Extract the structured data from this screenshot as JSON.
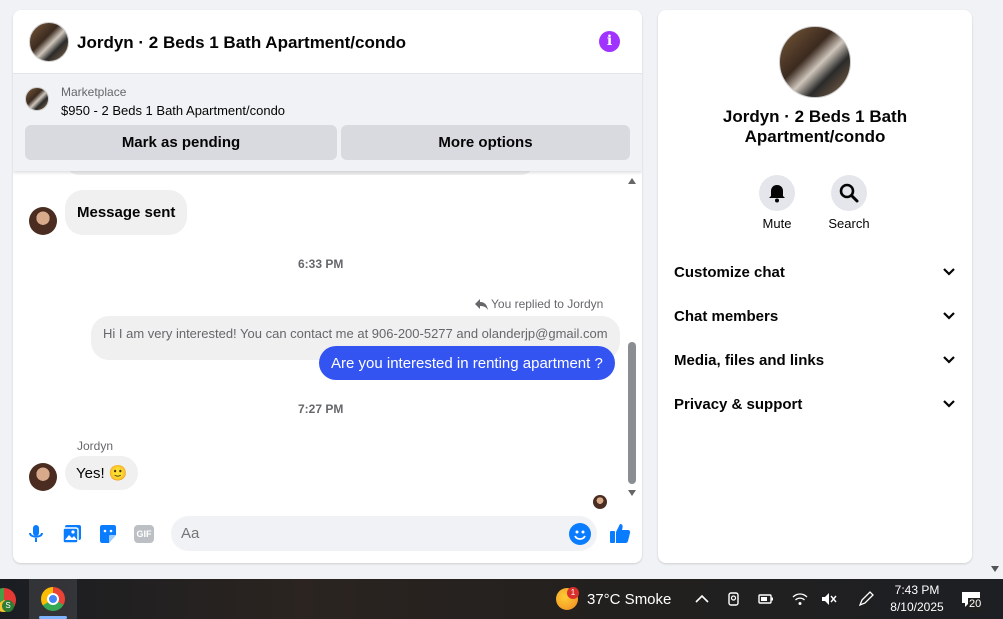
{
  "chat_header": {
    "title": "Jordyn · 2 Beds 1 Bath Apartment/condo",
    "info_icon": "info-icon"
  },
  "marketplace": {
    "label": "Marketplace",
    "listing": "$950 - 2 Beds 1 Bath Apartment/condo",
    "mark_pending_label": "Mark as pending",
    "more_options_label": "More options"
  },
  "messages": {
    "sent_status": "Message sent",
    "time_1": "6:33 PM",
    "reply_note": "You replied to Jordyn",
    "quoted_text": "Hi I am very interested! You can contact me at 906-200-5277 and olanderjp@gmail.com",
    "outgoing_text": "Are you interested in renting apartment ?",
    "time_2": "7:27 PM",
    "sender_name": "Jordyn",
    "incoming_text": "Yes!",
    "incoming_emoji": "🙂"
  },
  "composer": {
    "placeholder": "Aa",
    "icons": [
      "microphone-icon",
      "gallery-icon",
      "sticker-icon",
      "gif-icon",
      "emoji-icon",
      "thumbs-up-icon"
    ],
    "gif_label": "GIF"
  },
  "info_panel": {
    "name": "Jordyn · 2 Beds 1 Bath Apartment/condo",
    "mute_label": "Mute",
    "search_label": "Search",
    "sections": [
      {
        "label": "Customize chat"
      },
      {
        "label": "Chat members"
      },
      {
        "label": "Media, files and links"
      },
      {
        "label": "Privacy & support"
      }
    ]
  },
  "taskbar": {
    "app1_badge": "S",
    "weather_badge": "1",
    "weather": "37°C  Smoke",
    "time": "7:43 PM",
    "date": "8/10/2025",
    "notification_count": "20"
  },
  "colors": {
    "accent_blue": "#3454f2",
    "messenger_blue": "#0a7cff",
    "info_purple": "#a033ff"
  }
}
